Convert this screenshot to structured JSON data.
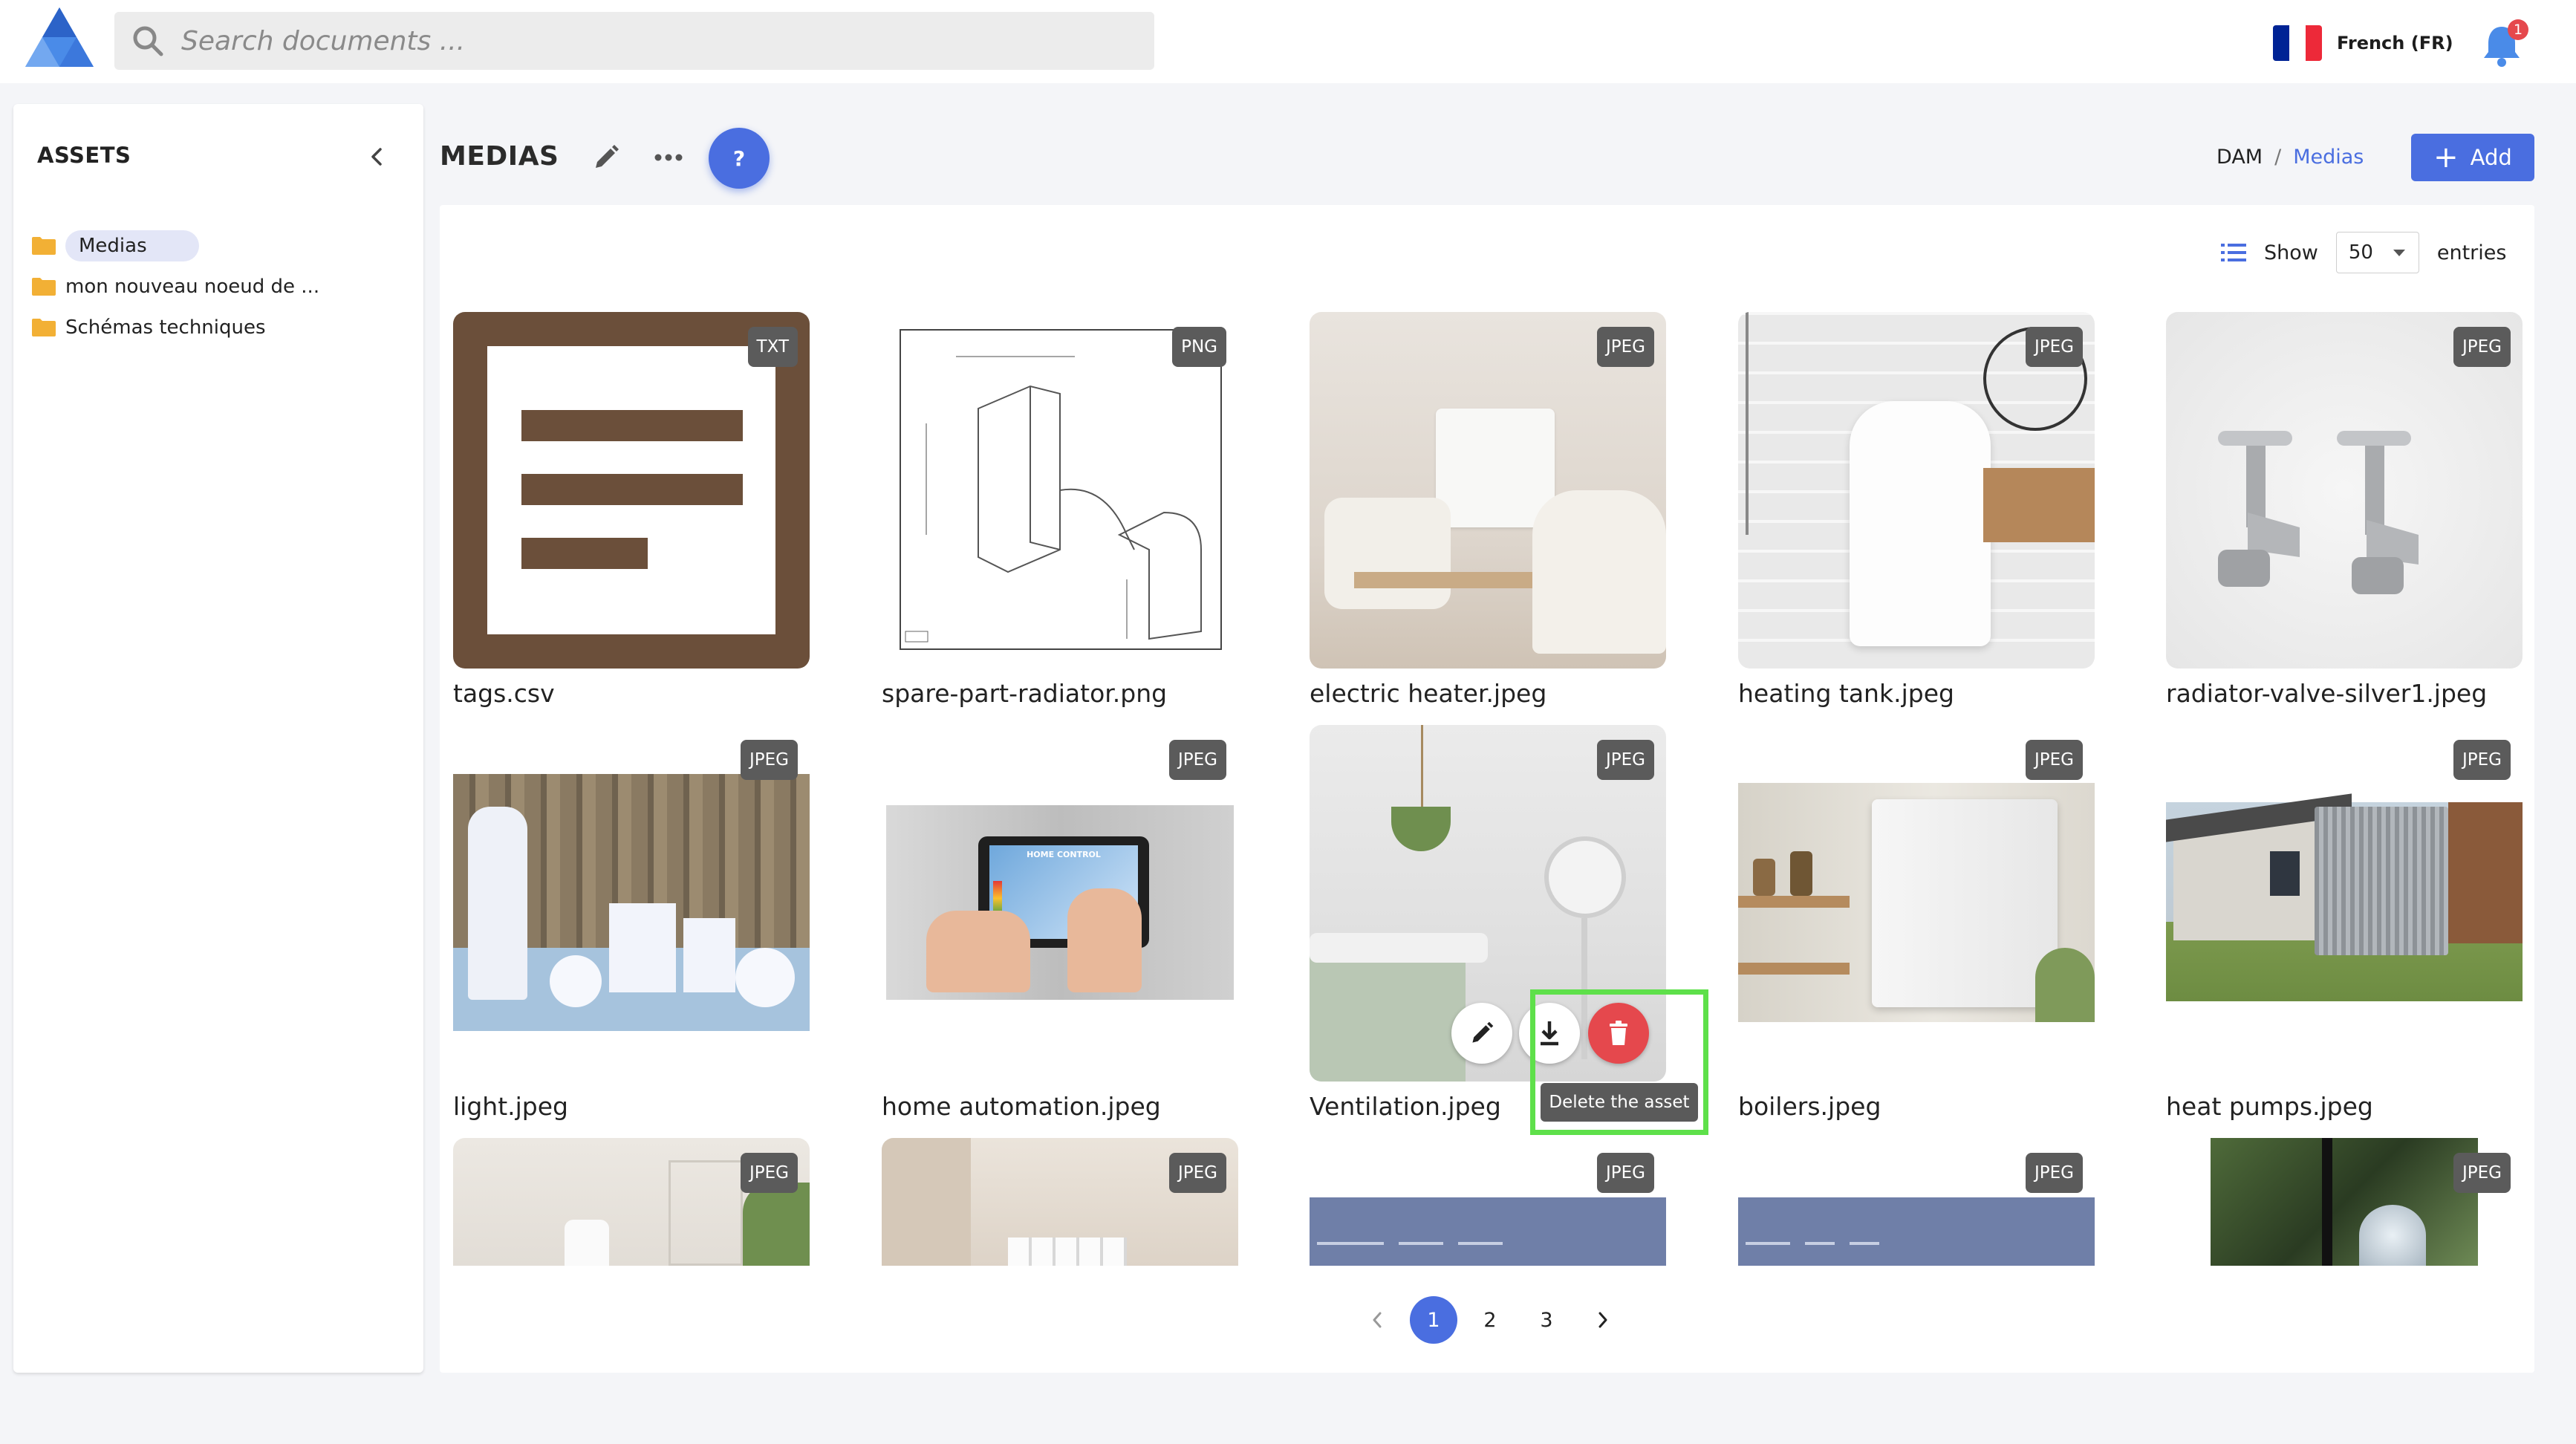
{
  "search": {
    "placeholder": "Search documents ..."
  },
  "language": {
    "label": "French (FR)",
    "flag_colors": [
      "#002395",
      "#ffffff",
      "#ed2939"
    ]
  },
  "notifications": {
    "count": "1"
  },
  "sidebar": {
    "title": "ASSETS",
    "items": [
      {
        "label": "Medias"
      },
      {
        "label": "mon nouveau noeud de ..."
      },
      {
        "label": "Schémas techniques"
      }
    ]
  },
  "header": {
    "title": "MEDIAS",
    "help_label": "?",
    "breadcrumb": [
      {
        "label": "DAM"
      },
      {
        "separator": "/"
      },
      {
        "label": "Medias"
      }
    ],
    "add_label": "Add"
  },
  "toolbar": {
    "show_label": "Show",
    "entries_value": "50",
    "entries_label": "entries"
  },
  "assets": [
    {
      "name": "tags.csv",
      "badge": "TXT"
    },
    {
      "name": "spare-part-radiator.png",
      "badge": "PNG"
    },
    {
      "name": "electric heater.jpeg",
      "badge": "JPEG"
    },
    {
      "name": "heating tank.jpeg",
      "badge": "JPEG"
    },
    {
      "name": "radiator-valve-silver1.jpeg",
      "badge": "JPEG"
    },
    {
      "name": "light.jpeg",
      "badge": "JPEG"
    },
    {
      "name": "home automation.jpeg",
      "badge": "JPEG"
    },
    {
      "name": "Ventilation.jpeg",
      "badge": "JPEG"
    },
    {
      "name": "boilers.jpeg",
      "badge": "JPEG"
    },
    {
      "name": "heat pumps.jpeg",
      "badge": "JPEG"
    },
    {
      "badge": "JPEG"
    },
    {
      "badge": "JPEG"
    },
    {
      "badge": "JPEG"
    },
    {
      "badge": "JPEG"
    },
    {
      "badge": "JPEG"
    }
  ],
  "thumb_screen_text": "HOME CONTROL",
  "tooltip": {
    "delete": "Delete the asset"
  },
  "pagination": {
    "pages": [
      "1",
      "2",
      "3"
    ],
    "current": "1"
  },
  "colors": {
    "accent": "#4a6ee0",
    "danger": "#e5484d",
    "highlight": "#5ee04a",
    "txt_icon": "#6a4e3b"
  }
}
